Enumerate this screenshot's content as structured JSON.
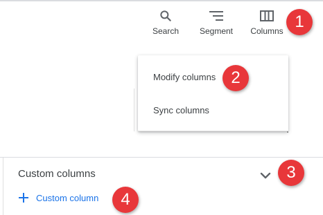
{
  "toolbar": {
    "search_label": "Search",
    "segment_label": "Segment",
    "columns_label": "Columns"
  },
  "columns_menu": {
    "items": [
      {
        "label": "Modify columns"
      },
      {
        "label": "Sync columns"
      }
    ]
  },
  "custom_columns_panel": {
    "title": "Custom columns",
    "add_link_label": "Custom column"
  },
  "annotations": [
    "1",
    "2",
    "3",
    "4"
  ],
  "colors": {
    "badge": "#e8373a",
    "link": "#1a73e8",
    "text": "#3c4043",
    "icon": "#5f6368"
  },
  "icons": [
    "search-icon",
    "segment-icon",
    "columns-icon",
    "chevron-down-icon",
    "plus-icon"
  ]
}
